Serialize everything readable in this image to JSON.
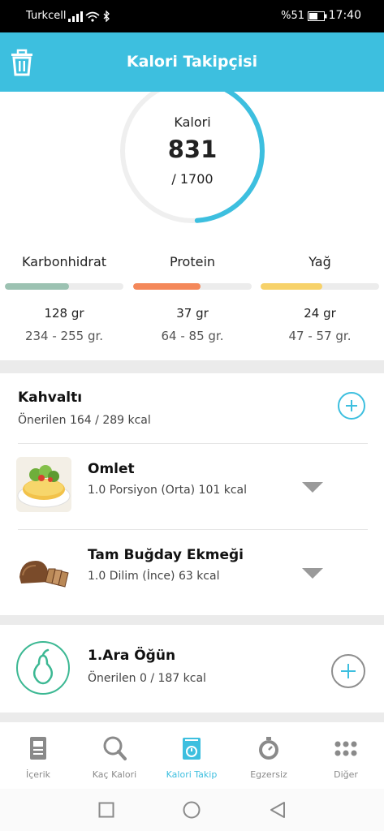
{
  "status_bar": {
    "carrier": "Turkcell",
    "battery": "%51",
    "time": "17:40"
  },
  "app_bar": {
    "title": "Kalori Takipçisi",
    "icon": "trash-icon"
  },
  "summary": {
    "calorie_label": "Kalori",
    "calorie_value": "831",
    "calorie_goal": "/ 1700",
    "progress_fraction": 0.489,
    "macros": [
      {
        "name": "Karbonhidrat",
        "amount": "128 gr",
        "range": "234 - 255 gr.",
        "progress": 0.54,
        "color": "#9cc2b2"
      },
      {
        "name": "Protein",
        "amount": "37 gr",
        "range": "64 - 85 gr.",
        "progress": 0.57,
        "color": "#f4885a"
      },
      {
        "name": "Yağ",
        "amount": "24 gr",
        "range": "47 - 57 gr.",
        "progress": 0.52,
        "color": "#f7d26a"
      }
    ]
  },
  "breakfast": {
    "title": "Kahvaltı",
    "subtitle": "Önerilen 164 / 289 kcal",
    "items": [
      {
        "name": "Omlet",
        "detail": "1.0 Porsiyon (Orta) 101 kcal"
      },
      {
        "name": "Tam Buğday Ekmeği",
        "detail": "1.0 Dilim (İnce) 63 kcal"
      }
    ]
  },
  "snack": {
    "title": "1.Ara Öğün",
    "subtitle": "Önerilen 0 / 187 kcal"
  },
  "bottom_nav": [
    {
      "label": "İçerik",
      "icon": "document-icon"
    },
    {
      "label": "Kaç Kalori",
      "icon": "search-icon"
    },
    {
      "label": "Kalori Takip",
      "icon": "scale-icon",
      "active": true
    },
    {
      "label": "Egzersiz",
      "icon": "stopwatch-icon"
    },
    {
      "label": "Diğer",
      "icon": "more-grid-icon"
    }
  ],
  "colors": {
    "accent": "#3dbfdf",
    "snack_green": "#3cb893"
  }
}
